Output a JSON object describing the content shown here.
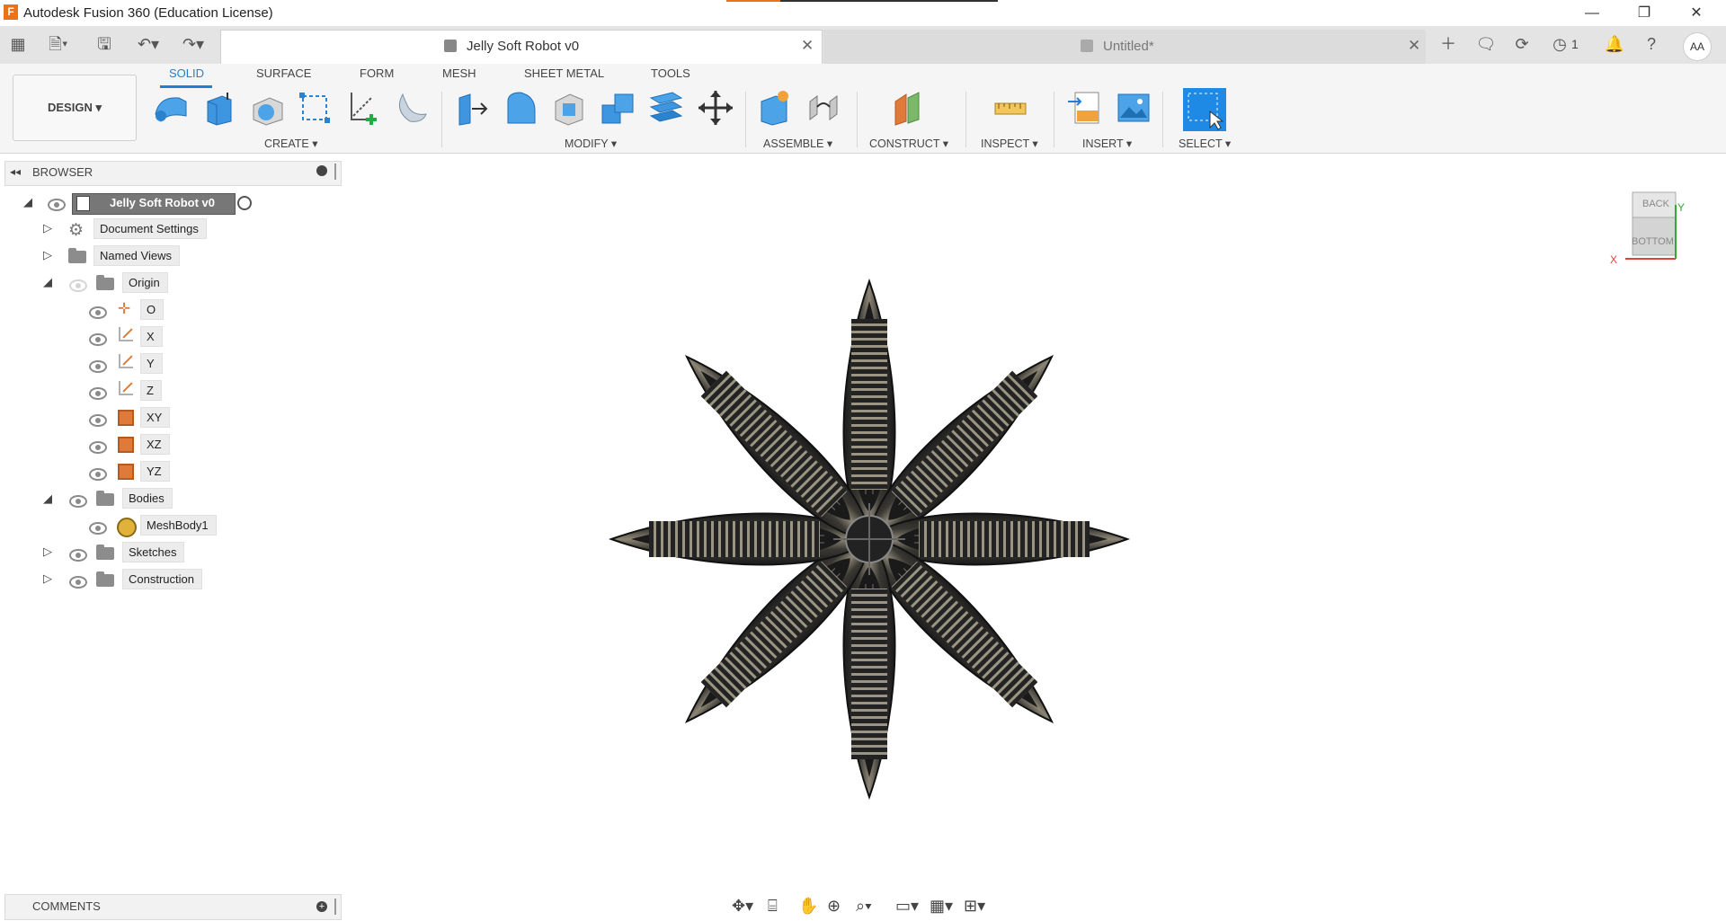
{
  "app": {
    "title": "Autodesk Fusion 360 (Education License)",
    "logo_letter": "F"
  },
  "window_controls": {
    "minimize": "—",
    "restore": "❐",
    "close": "✕"
  },
  "tabs": [
    {
      "label": "Jelly Soft Robot v0",
      "active": true
    },
    {
      "label": "Untitled*",
      "active": false
    }
  ],
  "status": {
    "jobs_count": "1",
    "user_initials": "AA"
  },
  "workspace": {
    "label": "DESIGN ▾"
  },
  "ribbon_tabs": [
    "SOLID",
    "SURFACE",
    "FORM",
    "MESH",
    "SHEET METAL",
    "TOOLS"
  ],
  "tool_groups": [
    "CREATE ▾",
    "MODIFY ▾",
    "ASSEMBLE ▾",
    "CONSTRUCT ▾",
    "INSPECT ▾",
    "INSERT ▾",
    "SELECT ▾"
  ],
  "browser": {
    "title": "BROWSER",
    "root": "Jelly Soft Robot v0",
    "items": {
      "document_settings": "Document Settings",
      "named_views": "Named Views",
      "origin": "Origin",
      "origin_children": [
        "O",
        "X",
        "Y",
        "Z",
        "XY",
        "XZ",
        "YZ"
      ],
      "bodies": "Bodies",
      "mesh_body": "MeshBody1",
      "sketches": "Sketches",
      "construction": "Construction"
    }
  },
  "viewcube": {
    "top_face": "BACK",
    "front_face": "BOTTOM",
    "axis_x": "X",
    "axis_y": "Y"
  },
  "comments": {
    "title": "COMMENTS"
  },
  "colors": {
    "accent": "#1f7fd6",
    "brand": "#e8731a",
    "model_dark": "#2a2a2a",
    "model_highlight": "#b9b29a"
  }
}
